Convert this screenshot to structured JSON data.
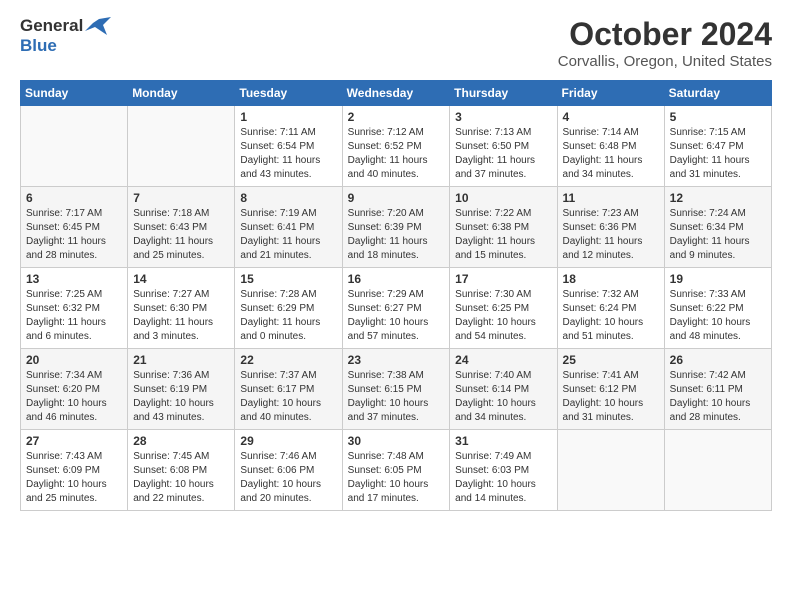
{
  "header": {
    "logo_general": "General",
    "logo_blue": "Blue",
    "title": "October 2024",
    "location": "Corvallis, Oregon, United States"
  },
  "weekdays": [
    "Sunday",
    "Monday",
    "Tuesday",
    "Wednesday",
    "Thursday",
    "Friday",
    "Saturday"
  ],
  "weeks": [
    [
      {
        "day": "",
        "info": ""
      },
      {
        "day": "",
        "info": ""
      },
      {
        "day": "1",
        "info": "Sunrise: 7:11 AM\nSunset: 6:54 PM\nDaylight: 11 hours and 43 minutes."
      },
      {
        "day": "2",
        "info": "Sunrise: 7:12 AM\nSunset: 6:52 PM\nDaylight: 11 hours and 40 minutes."
      },
      {
        "day": "3",
        "info": "Sunrise: 7:13 AM\nSunset: 6:50 PM\nDaylight: 11 hours and 37 minutes."
      },
      {
        "day": "4",
        "info": "Sunrise: 7:14 AM\nSunset: 6:48 PM\nDaylight: 11 hours and 34 minutes."
      },
      {
        "day": "5",
        "info": "Sunrise: 7:15 AM\nSunset: 6:47 PM\nDaylight: 11 hours and 31 minutes."
      }
    ],
    [
      {
        "day": "6",
        "info": "Sunrise: 7:17 AM\nSunset: 6:45 PM\nDaylight: 11 hours and 28 minutes."
      },
      {
        "day": "7",
        "info": "Sunrise: 7:18 AM\nSunset: 6:43 PM\nDaylight: 11 hours and 25 minutes."
      },
      {
        "day": "8",
        "info": "Sunrise: 7:19 AM\nSunset: 6:41 PM\nDaylight: 11 hours and 21 minutes."
      },
      {
        "day": "9",
        "info": "Sunrise: 7:20 AM\nSunset: 6:39 PM\nDaylight: 11 hours and 18 minutes."
      },
      {
        "day": "10",
        "info": "Sunrise: 7:22 AM\nSunset: 6:38 PM\nDaylight: 11 hours and 15 minutes."
      },
      {
        "day": "11",
        "info": "Sunrise: 7:23 AM\nSunset: 6:36 PM\nDaylight: 11 hours and 12 minutes."
      },
      {
        "day": "12",
        "info": "Sunrise: 7:24 AM\nSunset: 6:34 PM\nDaylight: 11 hours and 9 minutes."
      }
    ],
    [
      {
        "day": "13",
        "info": "Sunrise: 7:25 AM\nSunset: 6:32 PM\nDaylight: 11 hours and 6 minutes."
      },
      {
        "day": "14",
        "info": "Sunrise: 7:27 AM\nSunset: 6:30 PM\nDaylight: 11 hours and 3 minutes."
      },
      {
        "day": "15",
        "info": "Sunrise: 7:28 AM\nSunset: 6:29 PM\nDaylight: 11 hours and 0 minutes."
      },
      {
        "day": "16",
        "info": "Sunrise: 7:29 AM\nSunset: 6:27 PM\nDaylight: 10 hours and 57 minutes."
      },
      {
        "day": "17",
        "info": "Sunrise: 7:30 AM\nSunset: 6:25 PM\nDaylight: 10 hours and 54 minutes."
      },
      {
        "day": "18",
        "info": "Sunrise: 7:32 AM\nSunset: 6:24 PM\nDaylight: 10 hours and 51 minutes."
      },
      {
        "day": "19",
        "info": "Sunrise: 7:33 AM\nSunset: 6:22 PM\nDaylight: 10 hours and 48 minutes."
      }
    ],
    [
      {
        "day": "20",
        "info": "Sunrise: 7:34 AM\nSunset: 6:20 PM\nDaylight: 10 hours and 46 minutes."
      },
      {
        "day": "21",
        "info": "Sunrise: 7:36 AM\nSunset: 6:19 PM\nDaylight: 10 hours and 43 minutes."
      },
      {
        "day": "22",
        "info": "Sunrise: 7:37 AM\nSunset: 6:17 PM\nDaylight: 10 hours and 40 minutes."
      },
      {
        "day": "23",
        "info": "Sunrise: 7:38 AM\nSunset: 6:15 PM\nDaylight: 10 hours and 37 minutes."
      },
      {
        "day": "24",
        "info": "Sunrise: 7:40 AM\nSunset: 6:14 PM\nDaylight: 10 hours and 34 minutes."
      },
      {
        "day": "25",
        "info": "Sunrise: 7:41 AM\nSunset: 6:12 PM\nDaylight: 10 hours and 31 minutes."
      },
      {
        "day": "26",
        "info": "Sunrise: 7:42 AM\nSunset: 6:11 PM\nDaylight: 10 hours and 28 minutes."
      }
    ],
    [
      {
        "day": "27",
        "info": "Sunrise: 7:43 AM\nSunset: 6:09 PM\nDaylight: 10 hours and 25 minutes."
      },
      {
        "day": "28",
        "info": "Sunrise: 7:45 AM\nSunset: 6:08 PM\nDaylight: 10 hours and 22 minutes."
      },
      {
        "day": "29",
        "info": "Sunrise: 7:46 AM\nSunset: 6:06 PM\nDaylight: 10 hours and 20 minutes."
      },
      {
        "day": "30",
        "info": "Sunrise: 7:48 AM\nSunset: 6:05 PM\nDaylight: 10 hours and 17 minutes."
      },
      {
        "day": "31",
        "info": "Sunrise: 7:49 AM\nSunset: 6:03 PM\nDaylight: 10 hours and 14 minutes."
      },
      {
        "day": "",
        "info": ""
      },
      {
        "day": "",
        "info": ""
      }
    ]
  ]
}
